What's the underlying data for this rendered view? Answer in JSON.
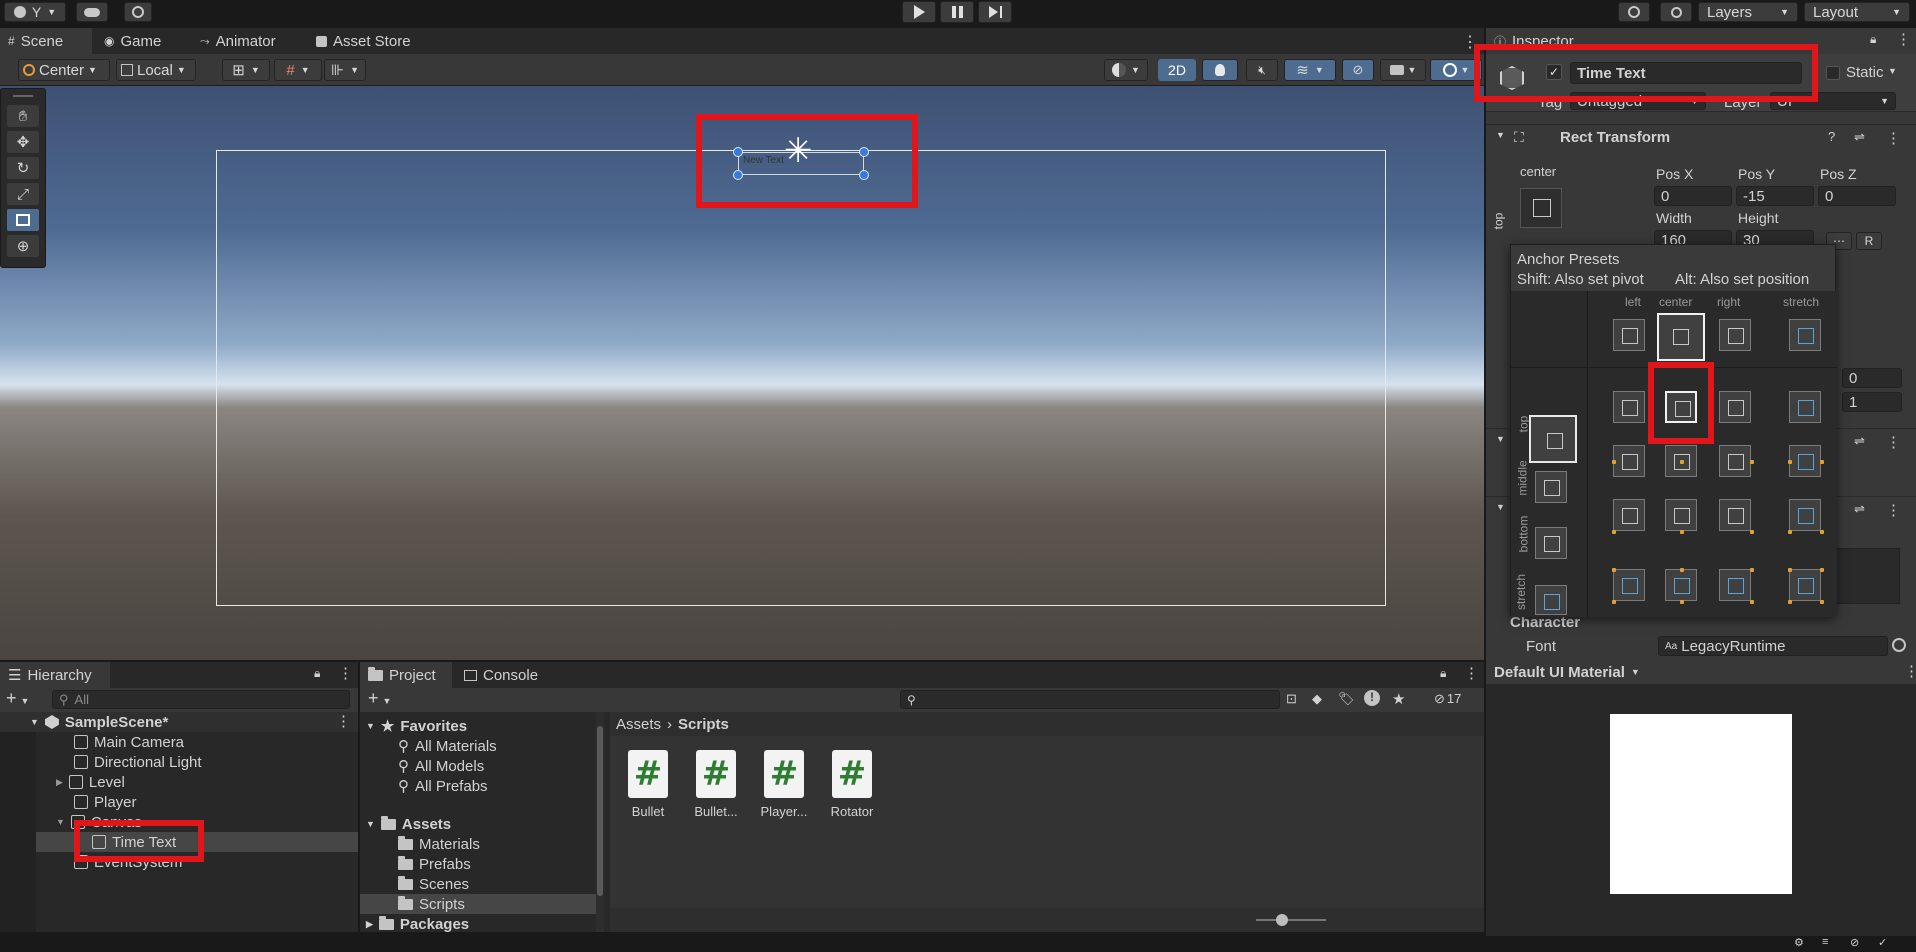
{
  "toolbar": {
    "account_label": "Y",
    "layers_label": "Layers",
    "layout_label": "Layout"
  },
  "scene_tabs": [
    {
      "label": "Scene"
    },
    {
      "label": "Game"
    },
    {
      "label": "Animator"
    },
    {
      "label": "Asset Store"
    }
  ],
  "scene_toolbar": {
    "pivot_label": "Center",
    "space_label": "Local",
    "mode_2d": "2D"
  },
  "scene_view": {
    "text_object": "New Text"
  },
  "hierarchy": {
    "tab_label": "Hierarchy",
    "search_placeholder": "All",
    "scene_name": "SampleScene*",
    "items": [
      {
        "label": "Main Camera"
      },
      {
        "label": "Directional Light"
      },
      {
        "label": "Level"
      },
      {
        "label": "Player"
      },
      {
        "label": "Canvas"
      },
      {
        "label": "Time Text"
      },
      {
        "label": "EventSystem"
      }
    ]
  },
  "project": {
    "tabs": [
      {
        "label": "Project"
      },
      {
        "label": "Console"
      }
    ],
    "hidden_count": "17",
    "favorites_label": "Favorites",
    "favorites": [
      {
        "label": "All Materials"
      },
      {
        "label": "All Models"
      },
      {
        "label": "All Prefabs"
      }
    ],
    "assets_label": "Assets",
    "asset_folders": [
      {
        "label": "Materials"
      },
      {
        "label": "Prefabs"
      },
      {
        "label": "Scenes"
      },
      {
        "label": "Scripts"
      }
    ],
    "packages_label": "Packages",
    "breadcrumb": [
      "Assets",
      "Scripts"
    ],
    "files": [
      {
        "label": "Bullet"
      },
      {
        "label": "Bullet..."
      },
      {
        "label": "Player..."
      },
      {
        "label": "Rotator"
      }
    ]
  },
  "inspector": {
    "tab_label": "Inspector",
    "object_name": "Time Text",
    "static_label": "Static",
    "tag_label": "Tag",
    "tag_value": "Untagged",
    "layer_label": "Layer",
    "layer_value": "UI",
    "rect_transform_label": "Rect Transform",
    "anchor_h": "center",
    "anchor_v": "top",
    "pos_x_label": "Pos X",
    "pos_x": "0",
    "pos_y_label": "Pos Y",
    "pos_y": "-15",
    "pos_z_label": "Pos Z",
    "pos_z": "0",
    "width_label": "Width",
    "width_value": "160",
    "height_label": "Height",
    "height_value": "30",
    "r_label": "R",
    "side_values": [
      "0",
      "1"
    ],
    "character_label": "Character",
    "font_label": "Font",
    "font_value": "LegacyRuntime",
    "material_label": "Default UI Material"
  },
  "anchor_presets": {
    "title": "Anchor Presets",
    "shift_hint": "Shift: Also set pivot",
    "alt_hint": "Alt: Also set position",
    "columns": [
      "left",
      "center",
      "right",
      "stretch"
    ],
    "rows": [
      "top",
      "middle",
      "bottom",
      "stretch"
    ]
  },
  "colors": {
    "highlight_red": "#e0161b",
    "panel": "#383838",
    "selection": "#4d6c8f"
  }
}
